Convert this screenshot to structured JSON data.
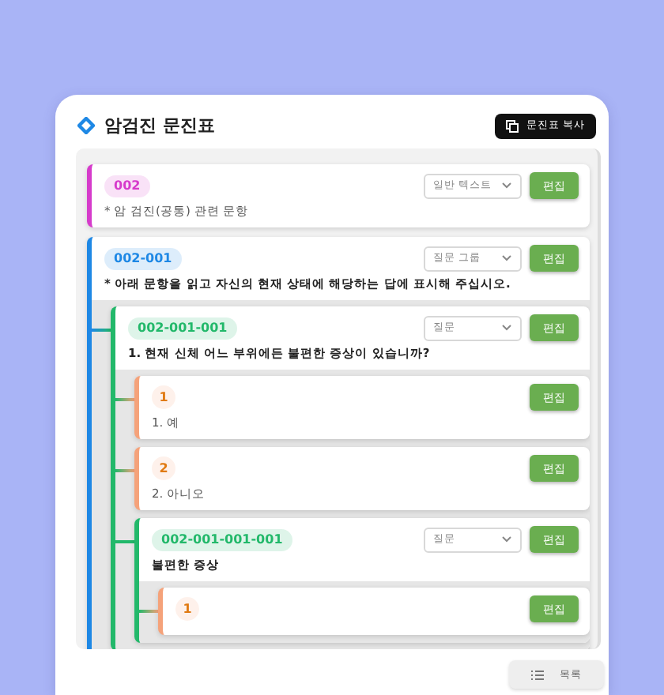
{
  "header": {
    "title": "암검진 문진표",
    "copy_button": "문진표 복사"
  },
  "nodes": [
    {
      "kind": "text",
      "code": "002",
      "color": "#d63bcb",
      "type": "일반 텍스트",
      "edit": "편집",
      "text": "* 암 검진(공통) 관련 문항"
    },
    {
      "kind": "question",
      "code": "002-001",
      "color": "#1e88e5",
      "type": "질문 그룹",
      "edit": "편집",
      "text": "* 아래 문항을 읽고 자신의 현재 상태에 해당하는 답에 표시해 주십시오.",
      "children": [
        {
          "kind": "question",
          "code": "002-001-001",
          "color": "#22b86a",
          "type": "질문",
          "edit": "편집",
          "text": "1. 현재 신체 어느 부위에든 불편한 증상이 있습니까?",
          "children": [
            {
              "kind": "option",
              "code": "1",
              "color": "#f5a27a",
              "edit": "편집",
              "text": "1. 예"
            },
            {
              "kind": "option",
              "code": "2",
              "color": "#f5a27a",
              "edit": "편집",
              "text": "2. 아니오"
            },
            {
              "kind": "question",
              "code": "002-001-001-001",
              "color": "#22b86a",
              "type": "질문",
              "edit": "편집",
              "text": "불편한 증상",
              "children": [
                {
                  "kind": "option",
                  "code": "1",
                  "color": "#f5a27a",
                  "edit": "편집"
                }
              ]
            }
          ]
        }
      ]
    }
  ],
  "list_button": "목록"
}
